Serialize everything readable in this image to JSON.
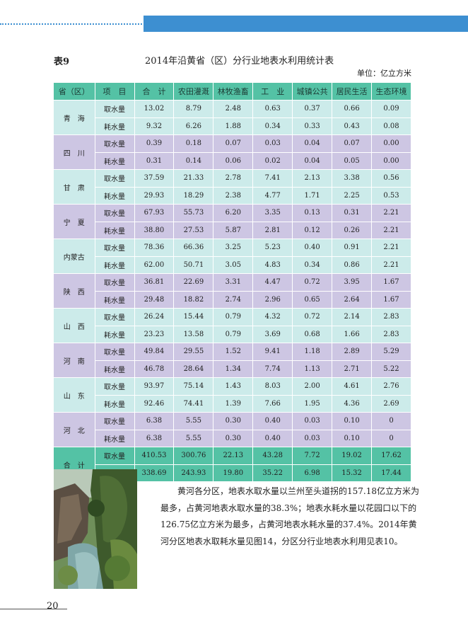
{
  "table_label": "表9",
  "table_title": "2014年沿黄省（区）分行业地表水利用统计表",
  "unit": "单位：亿立方米",
  "headers": [
    "省（区）",
    "项　目",
    "合　计",
    "农田灌溉",
    "林牧渔畜",
    "工　业",
    "城镇公共",
    "居民生活",
    "生态环境"
  ],
  "regions": [
    {
      "name": "青　海",
      "rows": [
        {
          "item": "取水量",
          "values": [
            "13.02",
            "8.79",
            "2.48",
            "0.63",
            "0.37",
            "0.66",
            "0.09"
          ]
        },
        {
          "item": "耗水量",
          "values": [
            "9.32",
            "6.26",
            "1.88",
            "0.34",
            "0.33",
            "0.43",
            "0.08"
          ]
        }
      ]
    },
    {
      "name": "四　川",
      "rows": [
        {
          "item": "取水量",
          "values": [
            "0.39",
            "0.18",
            "0.07",
            "0.03",
            "0.04",
            "0.07",
            "0.00"
          ]
        },
        {
          "item": "耗水量",
          "values": [
            "0.31",
            "0.14",
            "0.06",
            "0.02",
            "0.04",
            "0.05",
            "0.00"
          ]
        }
      ]
    },
    {
      "name": "甘　肃",
      "rows": [
        {
          "item": "取水量",
          "values": [
            "37.59",
            "21.33",
            "2.78",
            "7.41",
            "2.13",
            "3.38",
            "0.56"
          ]
        },
        {
          "item": "耗水量",
          "values": [
            "29.93",
            "18.29",
            "2.38",
            "4.77",
            "1.71",
            "2.25",
            "0.53"
          ]
        }
      ]
    },
    {
      "name": "宁　夏",
      "rows": [
        {
          "item": "取水量",
          "values": [
            "67.93",
            "55.73",
            "6.20",
            "3.35",
            "0.13",
            "0.31",
            "2.21"
          ]
        },
        {
          "item": "耗水量",
          "values": [
            "38.80",
            "27.53",
            "5.87",
            "2.81",
            "0.12",
            "0.26",
            "2.21"
          ]
        }
      ]
    },
    {
      "name": "内蒙古",
      "rows": [
        {
          "item": "取水量",
          "values": [
            "78.36",
            "66.36",
            "3.25",
            "5.23",
            "0.40",
            "0.91",
            "2.21"
          ]
        },
        {
          "item": "耗水量",
          "values": [
            "62.00",
            "50.71",
            "3.05",
            "4.83",
            "0.34",
            "0.86",
            "2.21"
          ]
        }
      ]
    },
    {
      "name": "陕　西",
      "rows": [
        {
          "item": "取水量",
          "values": [
            "36.81",
            "22.69",
            "3.31",
            "4.47",
            "0.72",
            "3.95",
            "1.67"
          ]
        },
        {
          "item": "耗水量",
          "values": [
            "29.48",
            "18.82",
            "2.74",
            "2.96",
            "0.65",
            "2.64",
            "1.67"
          ]
        }
      ]
    },
    {
      "name": "山　西",
      "rows": [
        {
          "item": "取水量",
          "values": [
            "26.24",
            "15.44",
            "0.79",
            "4.32",
            "0.72",
            "2.14",
            "2.83"
          ]
        },
        {
          "item": "耗水量",
          "values": [
            "23.23",
            "13.58",
            "0.79",
            "3.69",
            "0.68",
            "1.66",
            "2.83"
          ]
        }
      ]
    },
    {
      "name": "河　南",
      "rows": [
        {
          "item": "取水量",
          "values": [
            "49.84",
            "29.55",
            "1.52",
            "9.41",
            "1.18",
            "2.89",
            "5.29"
          ]
        },
        {
          "item": "耗水量",
          "values": [
            "46.78",
            "28.64",
            "1.34",
            "7.74",
            "1.13",
            "2.71",
            "5.22"
          ]
        }
      ]
    },
    {
      "name": "山　东",
      "rows": [
        {
          "item": "取水量",
          "values": [
            "93.97",
            "75.14",
            "1.43",
            "8.03",
            "2.00",
            "4.61",
            "2.76"
          ]
        },
        {
          "item": "耗水量",
          "values": [
            "92.46",
            "74.41",
            "1.39",
            "7.66",
            "1.95",
            "4.36",
            "2.69"
          ]
        }
      ]
    },
    {
      "name": "河　北",
      "rows": [
        {
          "item": "取水量",
          "values": [
            "6.38",
            "5.55",
            "0.30",
            "0.40",
            "0.03",
            "0.10",
            "0"
          ]
        },
        {
          "item": "耗水量",
          "values": [
            "6.38",
            "5.55",
            "0.30",
            "0.40",
            "0.03",
            "0.10",
            "0"
          ]
        }
      ]
    },
    {
      "name": "合　计",
      "rows": [
        {
          "item": "取水量",
          "values": [
            "410.53",
            "300.76",
            "22.13",
            "43.28",
            "7.72",
            "19.02",
            "17.62"
          ]
        },
        {
          "item": "耗水量",
          "values": [
            "338.69",
            "243.93",
            "19.80",
            "35.22",
            "6.98",
            "15.32",
            "17.44"
          ]
        }
      ]
    }
  ],
  "row_colors": {
    "teal": "#ccebea",
    "lavender": "#cdc6e3",
    "header": "#54c2a5",
    "band": "#3d8fd1"
  },
  "paragraph": "黄河各分区，地表水取水量以兰州至头道拐的157.18亿立方米为最多，占黄河地表水取水量的38.3%；地表水耗水量以花园口以下的126.75亿立方米为最多，占黄河地表水耗水量的37.4%。2014年黄河分区地表水取耗水量见图14，分区分行业地表水利用见表10。",
  "page_number": "20"
}
